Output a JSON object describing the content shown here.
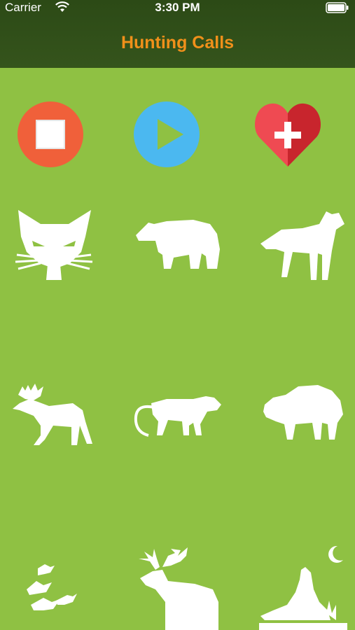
{
  "status_bar": {
    "carrier": "Carrier",
    "time": "3:30 PM"
  },
  "nav": {
    "title": "Hunting Calls"
  },
  "colors": {
    "background": "#8fc143",
    "header": "#2f4d18",
    "title": "#f0901a",
    "stop_button": "#f0603a",
    "play_button": "#4bb8f0",
    "favorite_heart": "#e0333a"
  },
  "controls": [
    {
      "name": "stop-button",
      "icon": "stop-icon"
    },
    {
      "name": "play-button",
      "icon": "play-icon"
    },
    {
      "name": "add-favorite-button",
      "icon": "heart-plus-icon"
    }
  ],
  "animals": [
    {
      "icon": "bobcat-icon"
    },
    {
      "icon": "bear-icon"
    },
    {
      "icon": "wolf-icon"
    },
    {
      "icon": "moose-icon"
    },
    {
      "icon": "mountain-lion-icon"
    },
    {
      "icon": "bison-icon"
    },
    {
      "icon": "ducks-icon"
    },
    {
      "icon": "elk-icon"
    },
    {
      "icon": "coyote-icon"
    }
  ]
}
